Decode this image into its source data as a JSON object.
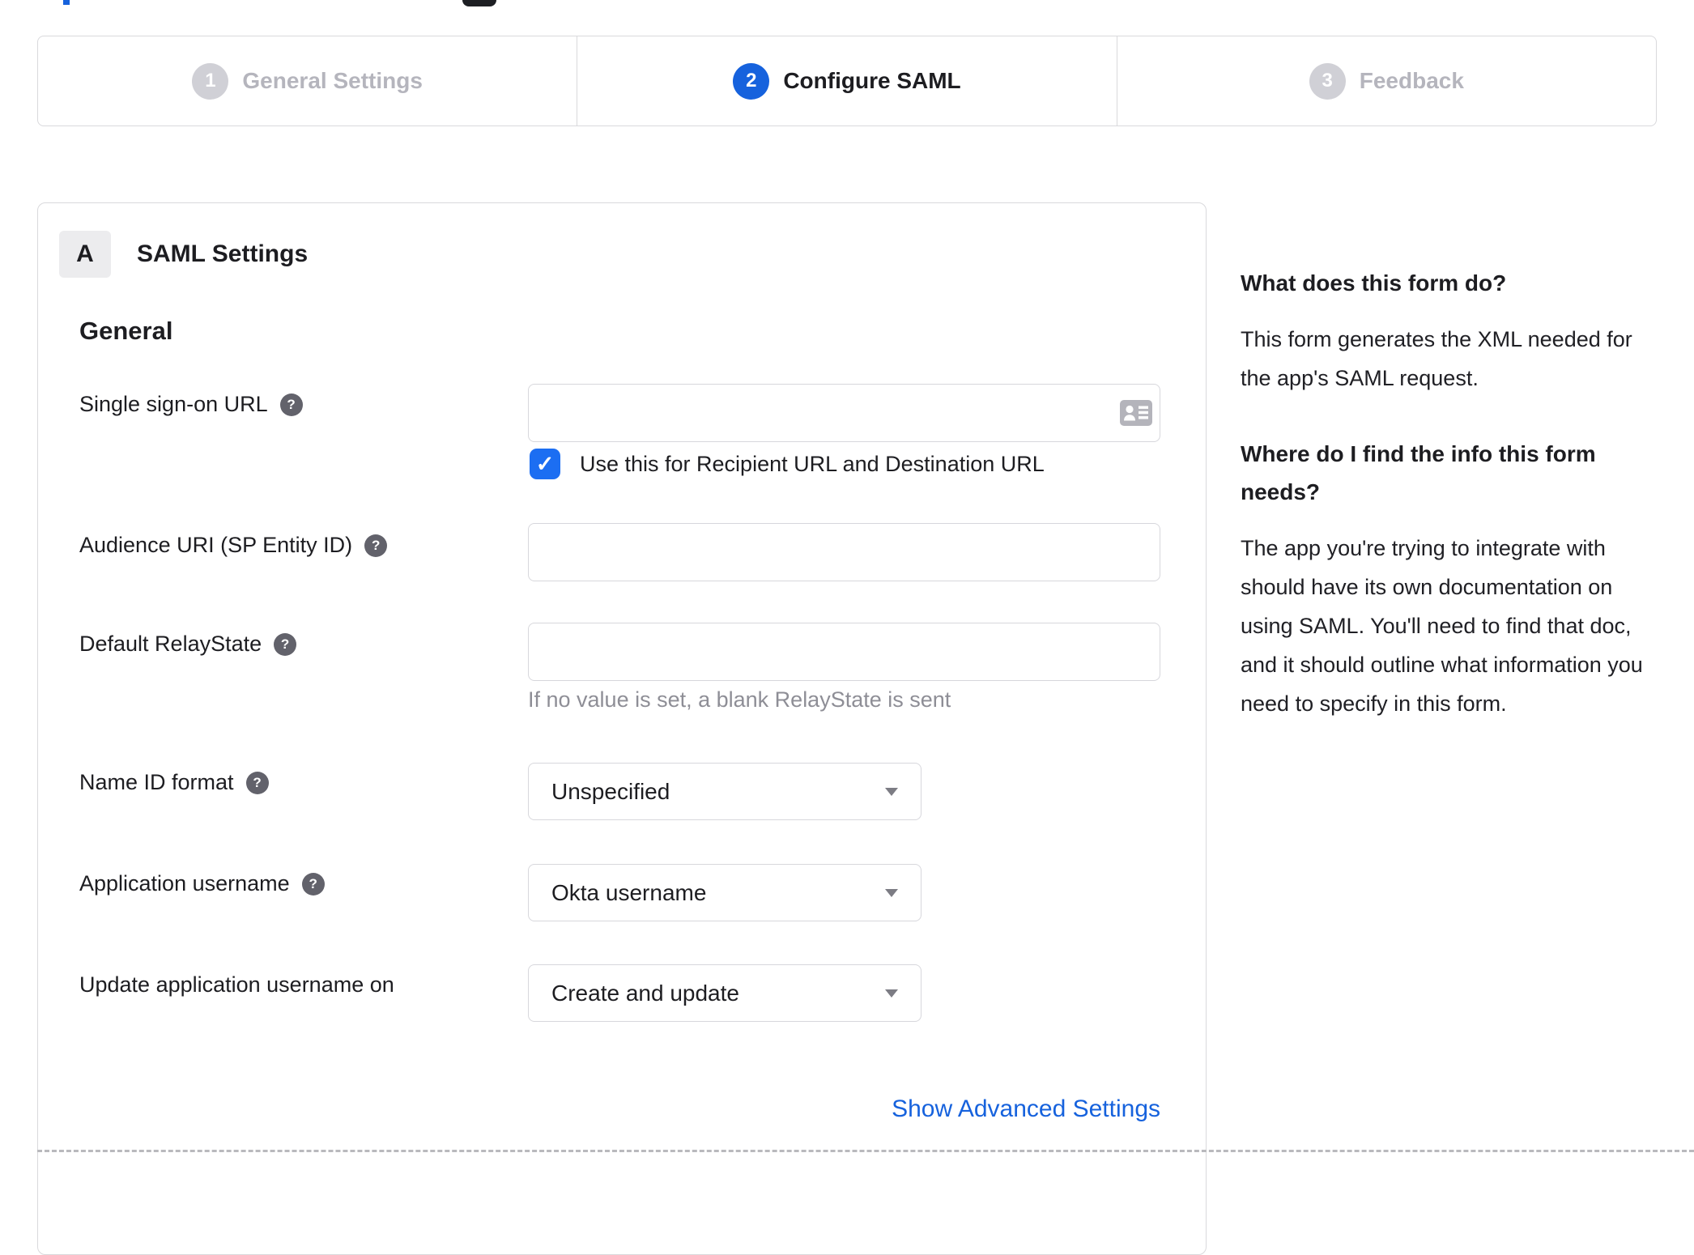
{
  "stepper": {
    "steps": [
      {
        "number": "1",
        "label": "General Settings",
        "state": "inactive"
      },
      {
        "number": "2",
        "label": "Configure SAML",
        "state": "active"
      },
      {
        "number": "3",
        "label": "Feedback",
        "state": "inactive"
      }
    ]
  },
  "panel": {
    "badge": "A",
    "title": "SAML Settings",
    "section_title": "General",
    "fields": {
      "sso_url": {
        "label": "Single sign-on URL",
        "value": "",
        "checkbox_label": "Use this for Recipient URL and Destination URL",
        "checkbox_checked": true
      },
      "audience_uri": {
        "label": "Audience URI (SP Entity ID)",
        "value": ""
      },
      "default_relaystate": {
        "label": "Default RelayState",
        "value": "",
        "hint": "If no value is set, a blank RelayState is sent"
      },
      "name_id_format": {
        "label": "Name ID format",
        "value": "Unspecified"
      },
      "application_username": {
        "label": "Application username",
        "value": "Okta username"
      },
      "update_application_username_on": {
        "label": "Update application username on",
        "value": "Create and update"
      }
    },
    "advanced_link": "Show Advanced Settings"
  },
  "help": {
    "sections": [
      {
        "heading": "What does this form do?",
        "body": "This form generates the XML needed for the app's SAML request."
      },
      {
        "heading": "Where do I find the info this form needs?",
        "body": "The app you're trying to integrate with should have its own documentation on using SAML. You'll need to find that doc, and it should outline what information you need to specify in this form."
      }
    ]
  },
  "icons": {
    "help": "?",
    "checkbox_check": "✓",
    "sso_input": "contact-card"
  },
  "colors": {
    "accent_blue": "#1662dd",
    "checkbox_blue": "#1c6ef2",
    "link_blue": "#1662dd",
    "inactive_gray": "#d0d0d6",
    "border_gray": "#d9d9dc"
  }
}
